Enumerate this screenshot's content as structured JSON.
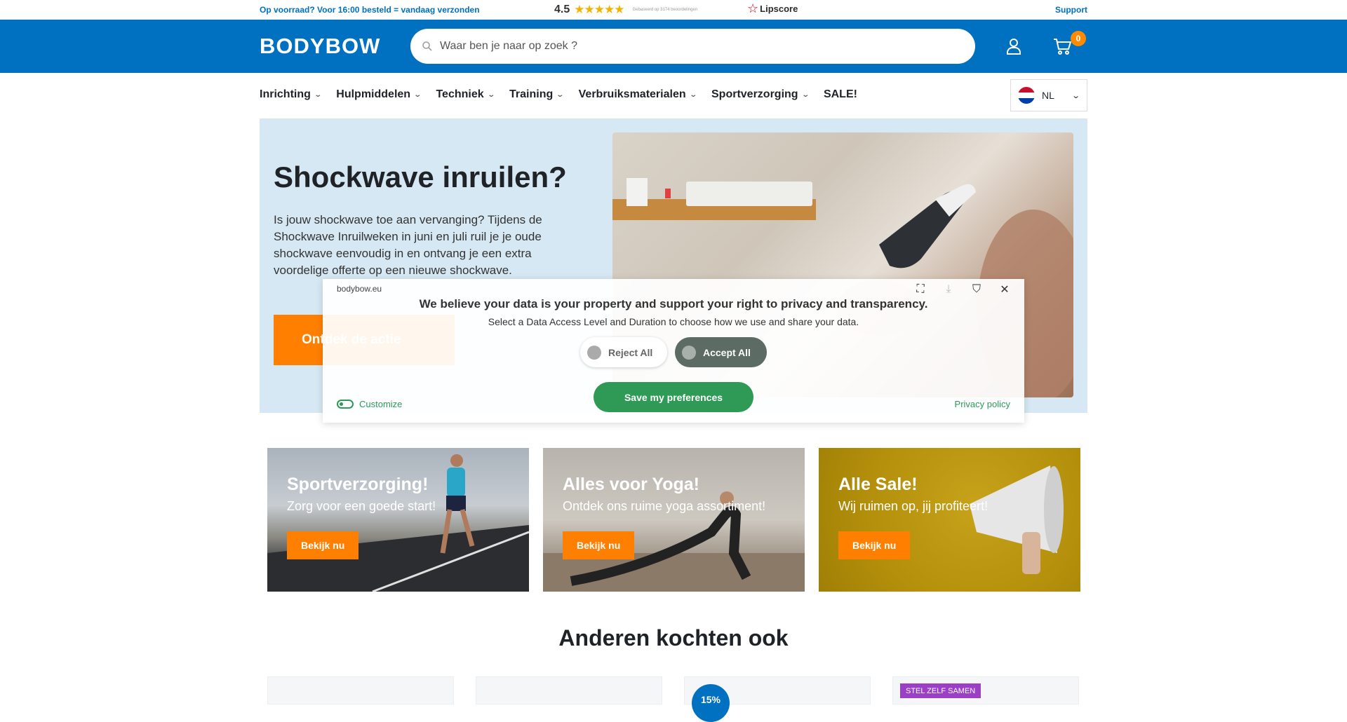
{
  "topbar": {
    "shipping": "Op voorraad? Voor 16:00 besteld = vandaag verzonden",
    "rating": "4.5",
    "rating_note": "Gebaseerd op 3174 beoordelingen",
    "rating_stars_out_of_5": 4.5,
    "lipscore": "Lipscore",
    "support": "Support"
  },
  "header": {
    "logo": "BODYBOW",
    "search_placeholder": "Waar ben je naar op zoek ?",
    "cart_count": "0"
  },
  "nav": {
    "items": [
      {
        "label": "Inrichting"
      },
      {
        "label": "Hulpmiddelen"
      },
      {
        "label": "Techniek"
      },
      {
        "label": "Training"
      },
      {
        "label": "Verbruiksmaterialen"
      },
      {
        "label": "Sportverzorging"
      },
      {
        "label": "SALE!"
      }
    ],
    "language": "NL"
  },
  "hero": {
    "title": "Shockwave inruilen?",
    "text": "Is jouw shockwave toe aan vervanging? Tijdens de Shockwave Inruilweken in juni en juli ruil je je oude shockwave eenvoudig in en ontvang je een extra voordelige offerte op een nieuwe shockwave.",
    "cta": "Ontdek de actie"
  },
  "consent": {
    "domain": "bodybow.eu",
    "heading": "We believe your data is your property and support your right to privacy and transparency.",
    "sub": "Select a Data Access Level and Duration to choose how we use and share your data.",
    "reject": "Reject All",
    "accept": "Accept All",
    "save": "Save my preferences",
    "customize": "Customize",
    "privacy": "Privacy policy"
  },
  "tiles": [
    {
      "title": "Sportverzorging!",
      "tagline": "Zorg voor een goede start!",
      "button": "Bekijk nu"
    },
    {
      "title": "Alles voor Yoga!",
      "tagline": "Ontdek ons ruime yoga assortiment!",
      "button": "Bekijk nu"
    },
    {
      "title": "Alle Sale!",
      "tagline": "Wij ruimen op, jij profiteert!",
      "button": "Bekijk nu"
    }
  ],
  "section_title": "Anderen kochten ook",
  "cards": {
    "discount": "15%",
    "badge": "STEL ZELF SAMEN"
  },
  "colors": {
    "brand_blue": "#0070c0",
    "accent_orange": "#ff7f00",
    "consent_green": "#2e9a55"
  }
}
